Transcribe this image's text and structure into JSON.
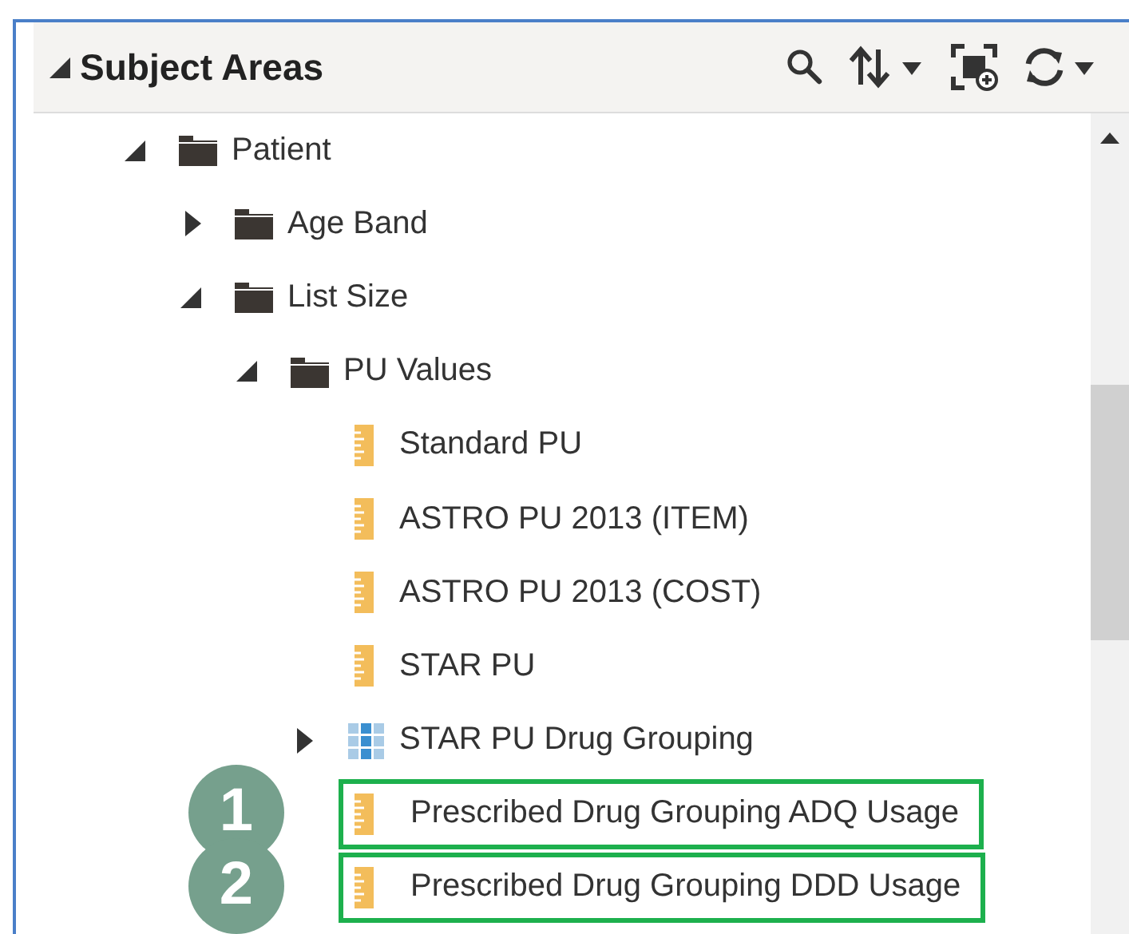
{
  "panel": {
    "title": "Subject Areas",
    "expanded": true
  },
  "tree": [
    {
      "label": "Patient",
      "kind": "folder",
      "expanded": true,
      "children": [
        {
          "label": "Age Band",
          "kind": "folder",
          "expanded": false
        },
        {
          "label": "List Size",
          "kind": "folder",
          "expanded": true,
          "children": [
            {
              "label": "PU Values",
              "kind": "folder",
              "expanded": true,
              "children": [
                {
                  "label": "Standard PU",
                  "kind": "measure"
                },
                {
                  "label": "ASTRO PU 2013 (ITEM)",
                  "kind": "measure"
                },
                {
                  "label": "ASTRO PU 2013 (COST)",
                  "kind": "measure"
                },
                {
                  "label": "STAR PU",
                  "kind": "measure"
                },
                {
                  "label": "STAR PU Drug Grouping",
                  "kind": "hierarchy",
                  "expanded": false
                },
                {
                  "label": "Prescribed Drug Grouping ADQ Usage",
                  "kind": "measure",
                  "highlighted": true,
                  "callout": "1"
                },
                {
                  "label": "Prescribed Drug Grouping DDD Usage",
                  "kind": "measure",
                  "highlighted": true,
                  "callout": "2"
                }
              ]
            }
          ]
        }
      ]
    }
  ]
}
